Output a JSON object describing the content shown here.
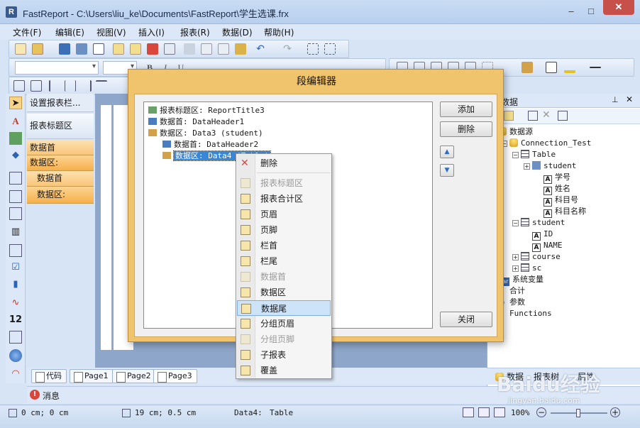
{
  "window": {
    "title": "FastReport - C:\\Users\\liu_ke\\Documents\\FastReport\\学生选课.frx",
    "icon_letter": "R",
    "controls": [
      "–",
      "□",
      "✕"
    ]
  },
  "menu": [
    "文件(F)",
    "编辑(E)",
    "视图(V)",
    "插入(I)",
    "报表(R)",
    "数据(D)",
    "帮助(H)"
  ],
  "bands_panel": {
    "configure": "设置报表栏...",
    "items": [
      {
        "label": "报表标题区"
      },
      {
        "label": "数据首"
      },
      {
        "label": "数据区:"
      },
      {
        "label": "数据首"
      },
      {
        "label": "数据区:"
      }
    ]
  },
  "page_tabs": [
    "代码",
    "Page1",
    "Page2",
    "Page3"
  ],
  "messages_tab": "消息",
  "status": {
    "pos1": "0 cm; 0 cm",
    "pos2": "19 cm; 0.5 cm",
    "object": "Data4:",
    "object_type": "Table",
    "zoom": "100%"
  },
  "data_panel": {
    "title": "数据",
    "tree": [
      {
        "label": "数据源",
        "icon": "database",
        "depth": 0
      },
      {
        "label": "Connection_Test",
        "icon": "database",
        "depth": 1,
        "expander": "−"
      },
      {
        "label": "Table",
        "icon": "table",
        "depth": 2,
        "expander": "−"
      },
      {
        "label": "student",
        "icon": "relation",
        "depth": 3,
        "expander": "+"
      },
      {
        "label": "学号",
        "icon": "field",
        "depth": 4
      },
      {
        "label": "姓名",
        "icon": "field",
        "depth": 4
      },
      {
        "label": "科目号",
        "icon": "field",
        "depth": 4
      },
      {
        "label": "科目名称",
        "icon": "field",
        "depth": 4
      },
      {
        "label": "student",
        "icon": "table",
        "depth": 2,
        "expander": "−"
      },
      {
        "label": "ID",
        "icon": "field",
        "depth": 3
      },
      {
        "label": "NAME",
        "icon": "field",
        "depth": 3
      },
      {
        "label": "course",
        "icon": "table",
        "depth": 2,
        "expander": "+"
      },
      {
        "label": "sc",
        "icon": "table",
        "depth": 2,
        "expander": "+"
      },
      {
        "label": "系统变量",
        "icon": "variable",
        "depth": 0
      },
      {
        "label": "合计",
        "icon": "sum",
        "depth": 0
      },
      {
        "label": "参数",
        "icon": "parameter",
        "depth": 0
      },
      {
        "label": "Functions",
        "icon": "function",
        "depth": 0
      }
    ],
    "tabs": [
      "数据",
      "报表树",
      "属性"
    ]
  },
  "dialog": {
    "title": "段编辑器",
    "tree": [
      {
        "label": "报表标题区: ReportTitle3",
        "depth": 0
      },
      {
        "label": "数据首: DataHeader1",
        "depth": 0
      },
      {
        "label": "数据区: Data3 (student)",
        "depth": 0
      },
      {
        "label": "数据首: DataHeader2",
        "depth": 1
      },
      {
        "label": "数据区: Data4 (Table)",
        "depth": 1,
        "selected": true
      }
    ],
    "buttons": {
      "add": "添加",
      "delete": "删除",
      "close": "关闭"
    },
    "move_up": "▲",
    "move_down": "▼"
  },
  "context_menu": [
    {
      "label": "删除",
      "icon": "delete",
      "enabled": true
    },
    {
      "label": "报表标题区",
      "icon": "report-title",
      "enabled": false
    },
    {
      "label": "报表合计区",
      "icon": "report-summary",
      "enabled": true
    },
    {
      "label": "页眉",
      "icon": "page-header",
      "enabled": true
    },
    {
      "label": "页脚",
      "icon": "page-footer",
      "enabled": true
    },
    {
      "label": "栏首",
      "icon": "column-header",
      "enabled": true
    },
    {
      "label": "栏尾",
      "icon": "column-footer",
      "enabled": true
    },
    {
      "label": "数据首",
      "icon": "data-header",
      "enabled": false
    },
    {
      "label": "数据区",
      "icon": "data-band",
      "enabled": true
    },
    {
      "label": "数据尾",
      "icon": "data-footer",
      "enabled": true,
      "selected": true
    },
    {
      "label": "分组页眉",
      "icon": "group-header",
      "enabled": true
    },
    {
      "label": "分组页脚",
      "icon": "group-footer",
      "enabled": false
    },
    {
      "label": "子报表",
      "icon": "child-band",
      "enabled": true
    },
    {
      "label": "覆盖",
      "icon": "overlay",
      "enabled": true
    }
  ],
  "watermark": {
    "text": "Baidu经验",
    "url": "jingyan.baidu.com"
  }
}
